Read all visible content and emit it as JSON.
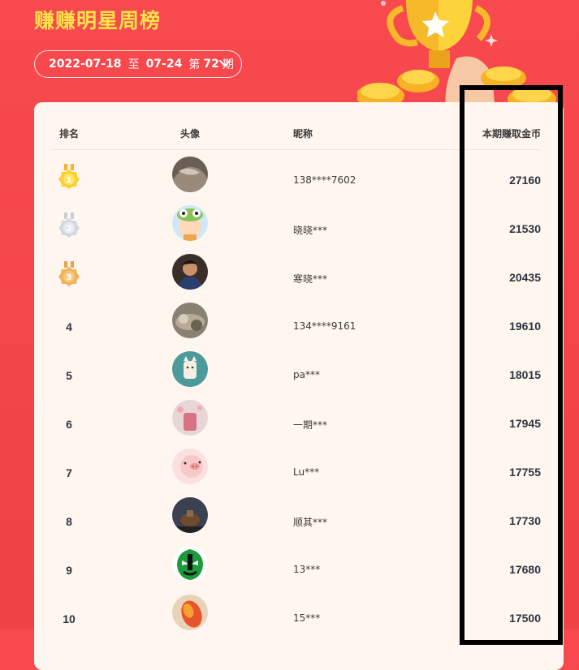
{
  "page": {
    "title": "赚赚明星周榜"
  },
  "period": {
    "start": "2022-07-18",
    "to": "至",
    "end": "07-24",
    "prefix": "第",
    "week": "72",
    "suffix": "期"
  },
  "table": {
    "headers": {
      "rank": "排名",
      "avatar": "头像",
      "nickname": "昵称",
      "coins": "本期赚取金币"
    },
    "rows": [
      {
        "rank": "1",
        "medal": "gold",
        "nickname": "138****7602",
        "coins": "27160"
      },
      {
        "rank": "2",
        "medal": "silver",
        "nickname": "晓晓***",
        "coins": "21530"
      },
      {
        "rank": "3",
        "medal": "bronze",
        "nickname": "寒晓***",
        "coins": "20435"
      },
      {
        "rank": "4",
        "nickname": "134****9161",
        "coins": "19610"
      },
      {
        "rank": "5",
        "nickname": "pa***",
        "coins": "18015"
      },
      {
        "rank": "6",
        "nickname": "一期***",
        "coins": "17945"
      },
      {
        "rank": "7",
        "nickname": "Lu***",
        "coins": "17755"
      },
      {
        "rank": "8",
        "nickname": "顺其***",
        "coins": "17730"
      },
      {
        "rank": "9",
        "nickname": "13***",
        "coins": "17680"
      },
      {
        "rank": "10",
        "nickname": "15***",
        "coins": "17500"
      }
    ]
  },
  "colors": {
    "background": "#f84a4e",
    "title": "#ffe14a",
    "card": "#fff7ef",
    "text": "#2f3441",
    "highlight": "#000000"
  },
  "icons": {
    "period_toggle": "chevron-down-icon",
    "decoration": "trophy-icon"
  }
}
